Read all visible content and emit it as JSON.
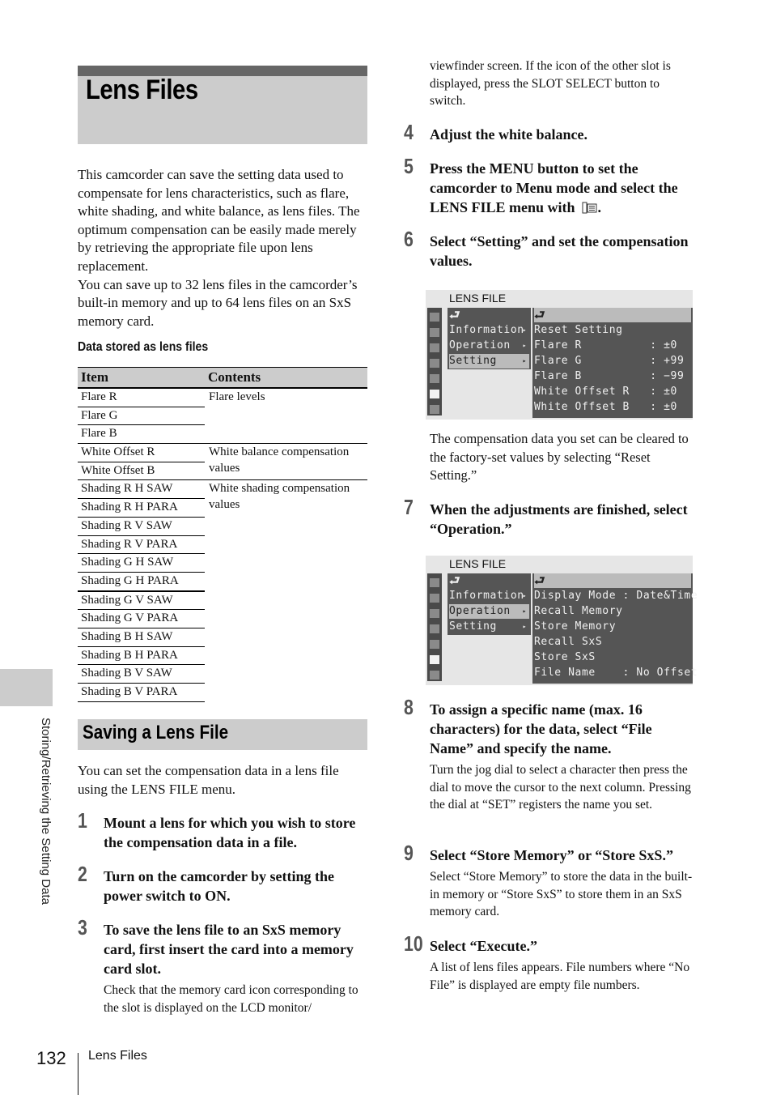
{
  "page": {
    "title": "Lens Files",
    "intro_paragraphs": [
      "This camcorder can save the setting data used to compensate for lens characteristics, such as flare, white shading, and white balance, as lens files. The optimum compensation can be easily made merely by retrieving the appropriate file upon lens replacement.",
      "You can save up to 32 lens files in the camcorder’s built-in memory and up to 64 lens files on an SxS memory card."
    ],
    "table_heading": "Data stored as lens files",
    "table": {
      "headers": [
        "Item",
        "Contents"
      ],
      "groups": [
        {
          "contents": "Flare levels",
          "items": [
            "Flare R",
            "Flare G",
            "Flare B"
          ]
        },
        {
          "contents": "White balance compensation values",
          "items": [
            "White Offset R",
            "White Offset B"
          ]
        },
        {
          "contents": "White shading compensation values",
          "items": [
            "Shading R H SAW",
            "Shading R H PARA",
            "Shading R V SAW",
            "Shading R V PARA",
            "Shading G H SAW",
            "Shading G H PARA",
            "Shading G V SAW",
            "Shading G V PARA",
            "Shading B H SAW",
            "Shading B H PARA",
            "Shading B V SAW",
            "Shading B V PARA"
          ]
        }
      ]
    },
    "section_title": "Saving a Lens File",
    "section_intro": "You can set the compensation data in a lens file using the LENS FILE menu.",
    "steps": [
      {
        "num": "1",
        "title": "Mount a lens for which you wish to store the compensation data in a file.",
        "desc": ""
      },
      {
        "num": "2",
        "title": "Turn on the camcorder by setting the power switch to ON.",
        "desc": ""
      },
      {
        "num": "3",
        "title": "To save the lens file to an SxS memory card, first insert the card into a memory card slot.",
        "desc": "Check that the memory card icon corresponding to the slot is displayed on the LCD monitor/"
      },
      {
        "num": "4",
        "title": "Adjust the white balance.",
        "desc": ""
      },
      {
        "num": "5",
        "title": "Press the MENU button to set the camcorder to Menu mode and select the LENS FILE menu with",
        "title_suffix": ".",
        "desc": ""
      },
      {
        "num": "6",
        "title": "Select “Setting” and set the compensation values.",
        "desc": "The compensation data you set can be cleared to the factory-set values by selecting “Reset Setting.”"
      },
      {
        "num": "7",
        "title": "When the adjustments are finished, select “Operation.”",
        "desc": ""
      },
      {
        "num": "8",
        "title": "To assign a specific name (max. 16 characters) for the data, select “File Name” and specify the name.",
        "desc": "Turn the jog dial to select a character then press the dial to move the cursor to the next column. Pressing the dial at “SET” registers the name you set."
      },
      {
        "num": "9",
        "title": "Select “Store Memory” or “Store SxS.”",
        "desc": "Select “Store Memory” to store the data in the built-in memory or “Store SxS” to store them in an SxS memory card."
      },
      {
        "num": "10",
        "title": "Select “Execute.”",
        "desc": "A list of lens files appears. File numbers where “No File” is displayed are empty file numbers."
      }
    ],
    "step3_continuation": "viewfinder screen. If the icon of the other slot is displayed, press the SLOT SELECT button to switch.",
    "screens": [
      {
        "title": "LENS FILE",
        "back_glyph": "⮐",
        "left_menu": [
          {
            "label": "Information",
            "selected": false
          },
          {
            "label": "Operation",
            "selected": false
          },
          {
            "label": "Setting",
            "selected": true
          }
        ],
        "right_menu": [
          "Reset Setting",
          "Flare R          : ±0",
          "Flare G          : +99",
          "Flare B          : −99",
          "White Offset R   : ±0",
          "White Offset B   : ±0"
        ]
      },
      {
        "title": "LENS FILE",
        "back_glyph": "⮐",
        "left_menu": [
          {
            "label": "Information",
            "selected": false
          },
          {
            "label": "Operation",
            "selected": true
          },
          {
            "label": "Setting",
            "selected": false
          }
        ],
        "right_menu": [
          "Display Mode : Date&Time",
          "Recall Memory",
          "Store Memory",
          "Recall SxS",
          "Store SxS",
          "File Name    : No Offset"
        ]
      }
    ],
    "side_label": "Storing/Retrieving the Setting Data",
    "footer": {
      "page_number": "132",
      "section": "Lens Files"
    },
    "icons": {
      "lens_file_menu": "lens-file-menu-icon",
      "menu_arrow": "▸"
    }
  }
}
